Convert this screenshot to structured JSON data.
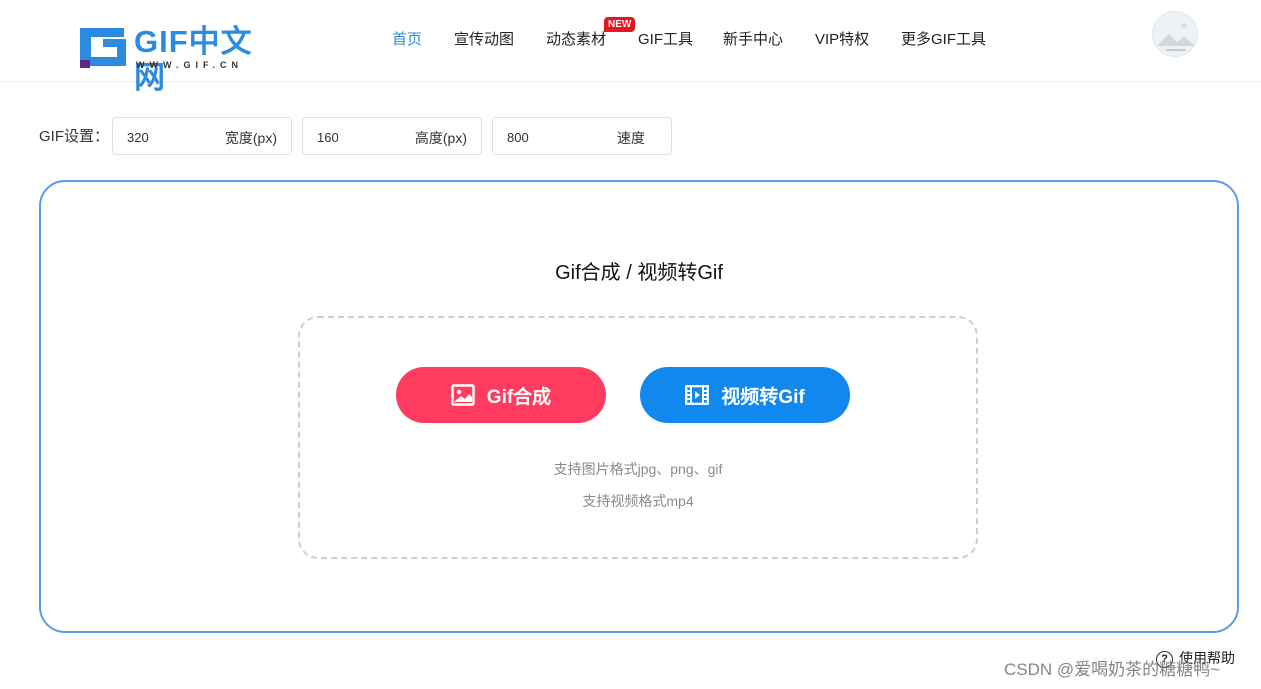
{
  "header": {
    "logo_text": "GIF中文网",
    "logo_sub": "WWW.GIF.CN",
    "nav": [
      {
        "label": "首页",
        "active": true
      },
      {
        "label": "宣传动图"
      },
      {
        "label": "动态素材",
        "badge": "NEW"
      },
      {
        "label": "GIF工具"
      },
      {
        "label": "新手中心"
      },
      {
        "label": "VIP特权"
      },
      {
        "label": "更多GIF工具"
      }
    ]
  },
  "settings": {
    "label": "GIF设置：",
    "width": {
      "value": "320",
      "unit": "宽度(px)"
    },
    "height": {
      "value": "160",
      "unit": "高度(px)"
    },
    "speed": {
      "value": "800",
      "unit": "速度"
    }
  },
  "panel": {
    "title": "Gif合成 / 视频转Gif",
    "btn_compose": "Gif合成",
    "btn_video": "视频转Gif",
    "hint_image": "支持图片格式jpg、png、gif",
    "hint_video": "支持视频格式mp4"
  },
  "help": {
    "label": "使用帮助"
  },
  "watermark": "CSDN @爱喝奶茶的糖糖鸭~",
  "colors": {
    "brand_blue": "#2b8be0",
    "compose_red": "#ff3c5f",
    "video_blue": "#1088ee",
    "panel_border": "#5a9be8",
    "badge_red": "#e6161e"
  }
}
